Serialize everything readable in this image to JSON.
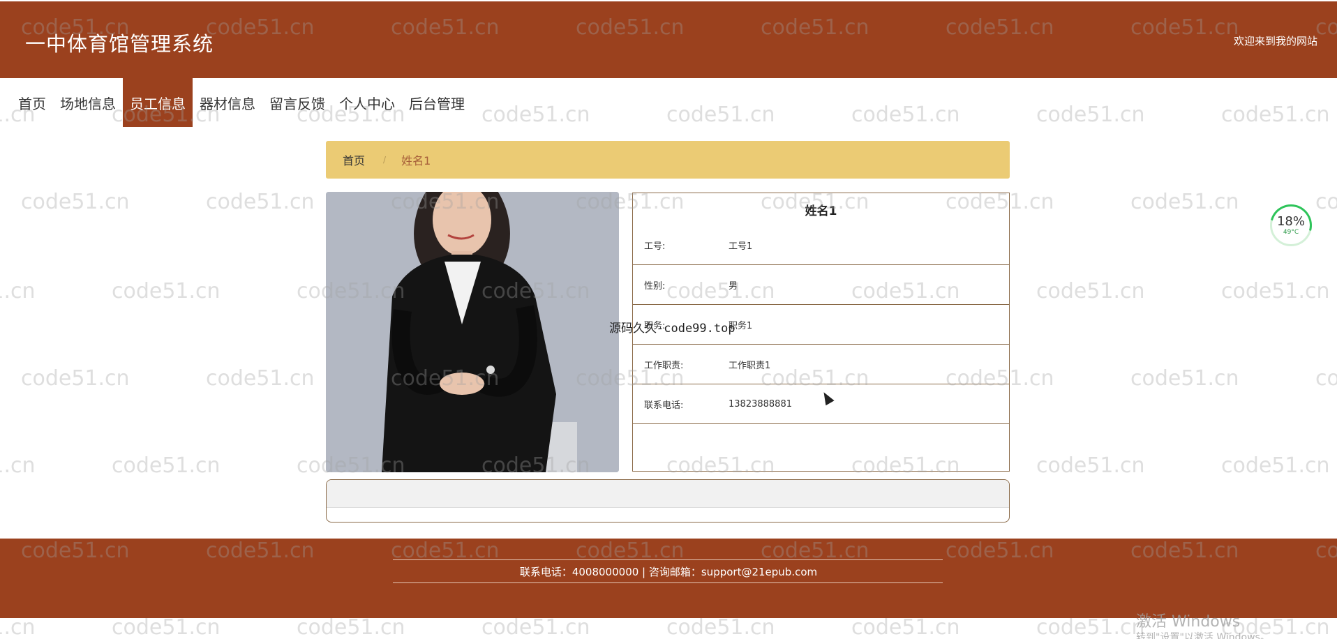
{
  "header": {
    "title": "一中体育馆管理系统",
    "welcome": "欢迎来到我的网站",
    "background_color": "#9b411e"
  },
  "nav": {
    "items": [
      {
        "label": "首页",
        "active": false
      },
      {
        "label": "场地信息",
        "active": false
      },
      {
        "label": "员工信息",
        "active": true
      },
      {
        "label": "器材信息",
        "active": false
      },
      {
        "label": "留言反馈",
        "active": false
      },
      {
        "label": "个人中心",
        "active": false
      },
      {
        "label": "后台管理",
        "active": false
      }
    ]
  },
  "breadcrumb": {
    "home": "首页",
    "separator": "/",
    "current": "姓名1"
  },
  "detail": {
    "name": "姓名1",
    "rows": [
      {
        "label": "工号:",
        "value": "工号1"
      },
      {
        "label": "性别:",
        "value": "男"
      },
      {
        "label": "职务:",
        "value": "职务1"
      },
      {
        "label": "工作职责:",
        "value": "工作职责1"
      },
      {
        "label": "联系电话:",
        "value": "13823888881"
      }
    ]
  },
  "footer": {
    "text": "联系电话：4008000000 | 咨询邮箱：support@21epub.com"
  },
  "watermark": {
    "text": "code51.cn",
    "center_text": "源码久久-code99.top"
  },
  "widget": {
    "percent": "18%",
    "temperature": "49°C"
  },
  "system": {
    "activate_line1": "激活 Windows",
    "activate_line2": "转到\"设置\"以激活 Windows。"
  }
}
